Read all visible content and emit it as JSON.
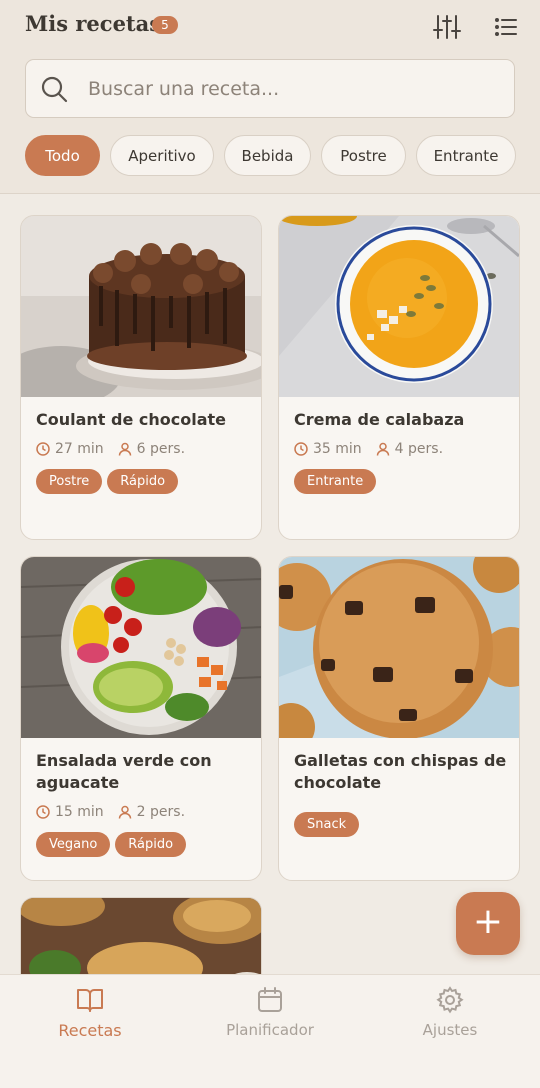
{
  "header": {
    "title": "Mis recetas",
    "count": "5",
    "filter_icon": "sliders-icon",
    "list_icon": "list-view-icon"
  },
  "search": {
    "placeholder": "Buscar una receta...",
    "value": ""
  },
  "filters": [
    {
      "label": "Todo",
      "active": true
    },
    {
      "label": "Aperitivo",
      "active": false
    },
    {
      "label": "Bebida",
      "active": false
    },
    {
      "label": "Postre",
      "active": false
    },
    {
      "label": "Entrante",
      "active": false
    }
  ],
  "recipes": [
    {
      "title": "Coulant de chocolate",
      "time": "27 min",
      "servings": "6 pers.",
      "tags": [
        "Postre",
        "Rápido"
      ]
    },
    {
      "title": "Crema de calabaza",
      "time": "35 min",
      "servings": "4 pers.",
      "tags": [
        "Entrante"
      ]
    },
    {
      "title": "Ensalada verde con aguacate",
      "time": "15 min",
      "servings": "2 pers.",
      "tags": [
        "Vegano",
        "Rápido"
      ]
    },
    {
      "title": "Galletas con chispas de chocolate",
      "time": "",
      "servings": "",
      "tags": [
        "Snack"
      ]
    }
  ],
  "fab": {
    "label": "+"
  },
  "nav": [
    {
      "label": "Recetas",
      "icon": "book-icon",
      "active": true
    },
    {
      "label": "Planificador",
      "icon": "calendar-icon",
      "active": false
    },
    {
      "label": "Ajustes",
      "icon": "gear-icon",
      "active": false
    }
  ],
  "colors": {
    "accent": "#c97a52",
    "background": "#f0ebe4",
    "card": "#f9f6f2",
    "muted_text": "#8d8379"
  }
}
